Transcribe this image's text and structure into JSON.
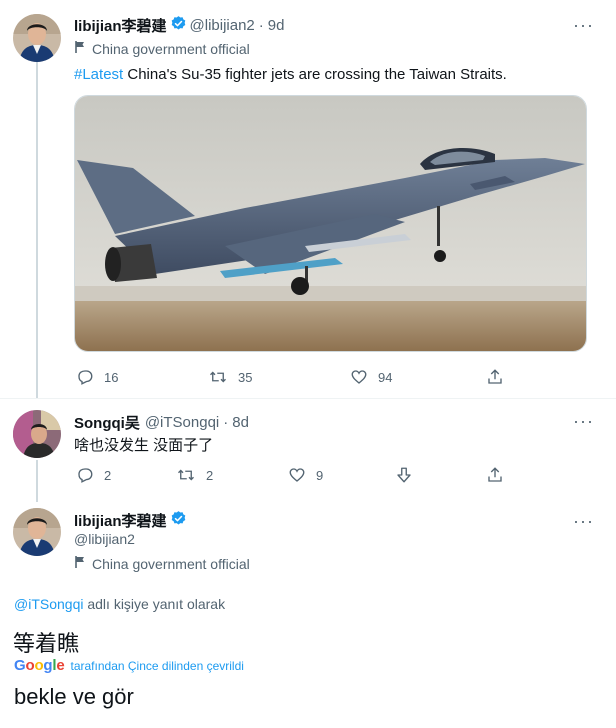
{
  "tweet1": {
    "name": "libijian李碧建",
    "handle": "@libijian2",
    "time": "9d",
    "label": "China government official",
    "hashtag": "#Latest",
    "text": " China's Su-35 fighter jets are crossing the Taiwan Straits.",
    "stats": {
      "replies": "16",
      "retweets": "35",
      "likes": "94"
    }
  },
  "tweet2": {
    "name": "Songqi吴",
    "handle": "@iTSongqi",
    "time": "8d",
    "text": "啥也没发生 没面子了",
    "stats": {
      "replies": "2",
      "retweets": "2",
      "likes": "9"
    }
  },
  "tweet3": {
    "name": "libijian李碧建",
    "handle": "@libijian2",
    "label": "China government official",
    "reply_mention": "@iTSongqi",
    "reply_suffix": " adlı kişiye yanıt olarak",
    "text": "等着瞧",
    "translation_source": "Google",
    "translation_note": "tarafından Çince dilinden çevrildi",
    "translation": "bekle ve gör"
  },
  "colors": {
    "accent": "#1d9bf0",
    "muted": "#536471",
    "text": "#0f1419"
  }
}
